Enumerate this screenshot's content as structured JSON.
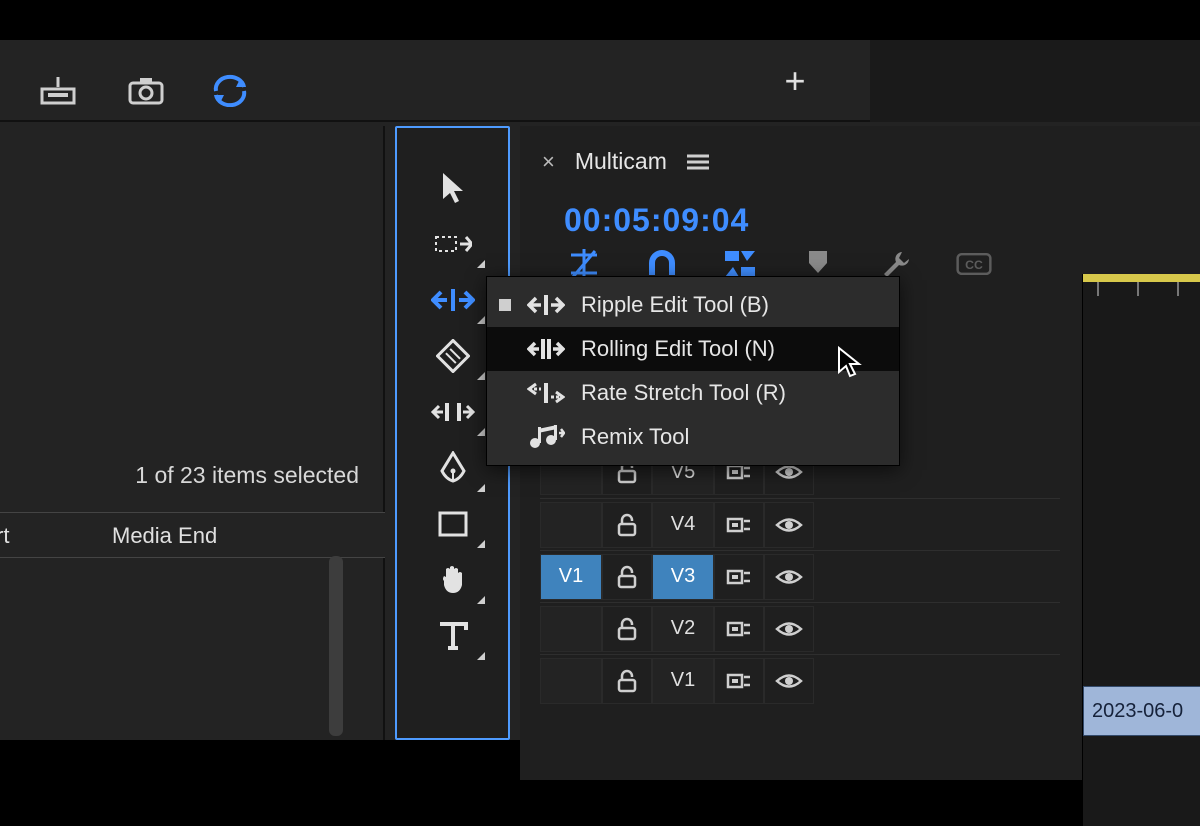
{
  "topbar": {
    "plus_label": "+"
  },
  "project": {
    "selection_text": "1 of 23 items selected",
    "col1": "rt",
    "col2": "Media End"
  },
  "sequence": {
    "tab_close": "×",
    "tab_name": "Multicam",
    "timecode": "00:05:09:04",
    "clip_label": "2023-06-0"
  },
  "tools_flyout": {
    "items": [
      {
        "label": "Ripple Edit Tool (B)",
        "active": true,
        "hover": false
      },
      {
        "label": "Rolling Edit Tool (N)",
        "active": false,
        "hover": true
      },
      {
        "label": "Rate Stretch Tool (R)",
        "active": false,
        "hover": false
      },
      {
        "label": "Remix Tool",
        "active": false,
        "hover": false
      }
    ]
  },
  "tracks": [
    {
      "src": "",
      "srcOn": false,
      "tgt": "V5",
      "tgtOn": false
    },
    {
      "src": "",
      "srcOn": false,
      "tgt": "V4",
      "tgtOn": false
    },
    {
      "src": "V1",
      "srcOn": true,
      "tgt": "V3",
      "tgtOn": true
    },
    {
      "src": "",
      "srcOn": false,
      "tgt": "V2",
      "tgtOn": false
    },
    {
      "src": "",
      "srcOn": false,
      "tgt": "V1",
      "tgtOn": false
    }
  ]
}
